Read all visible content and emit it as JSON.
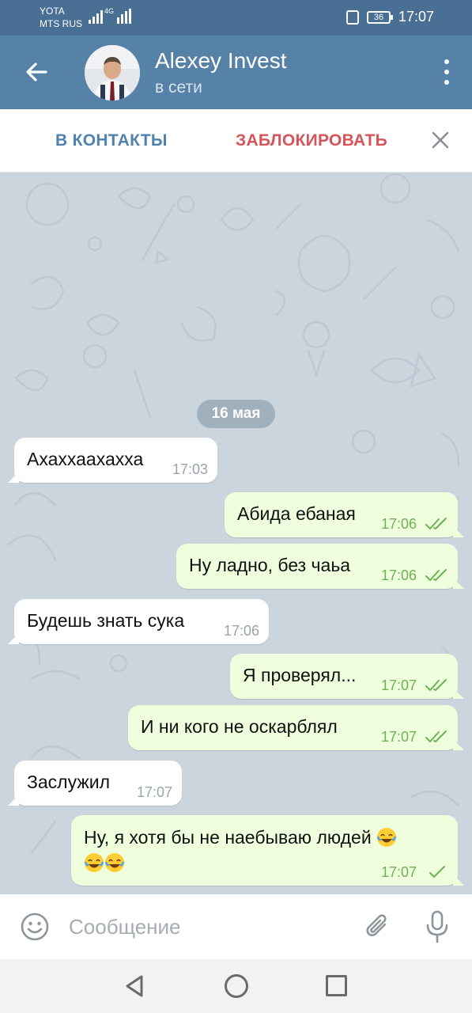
{
  "status": {
    "carrier1": "YOTA",
    "carrier2": "MTS RUS",
    "network": "4G",
    "battery": "36",
    "time": "17:07"
  },
  "header": {
    "contact_name": "Alexey Invest",
    "status": "в сети"
  },
  "actions": {
    "add_contact": "В КОНТАКТЫ",
    "block": "ЗАБЛОКИРОВАТЬ"
  },
  "chat": {
    "date": "16 мая",
    "messages": [
      {
        "dir": "in",
        "text": "Ахаххаахахха",
        "time": "17:03"
      },
      {
        "dir": "out",
        "text": "Абида ебаная",
        "time": "17:06",
        "status": "read"
      },
      {
        "dir": "out",
        "text": "Ну ладно, без чаьа",
        "time": "17:06",
        "status": "read"
      },
      {
        "dir": "in",
        "text": "Будешь знать сука",
        "time": "17:06"
      },
      {
        "dir": "out",
        "text": "Я проверял...",
        "time": "17:07",
        "status": "read"
      },
      {
        "dir": "out",
        "text": "И ни кого не оскарблял",
        "time": "17:07",
        "status": "read"
      },
      {
        "dir": "in",
        "text": "Заслужил",
        "time": "17:07"
      },
      {
        "dir": "out",
        "text": "Ну, я хотя бы не наебываю людей",
        "time": "17:07",
        "status": "sent",
        "emoji": "face-with-tears-of-joy x3"
      }
    ]
  },
  "composer": {
    "placeholder": "Сообщение"
  },
  "colors": {
    "header": "#5682a7",
    "statusbar": "#4a6f94",
    "chat_bg": "#cbd5dd",
    "out_bubble": "#effedd",
    "in_bubble": "#ffffff",
    "accent_blue": "#4f82ae",
    "accent_red": "#d5555a",
    "tick_green": "#6bb353"
  }
}
